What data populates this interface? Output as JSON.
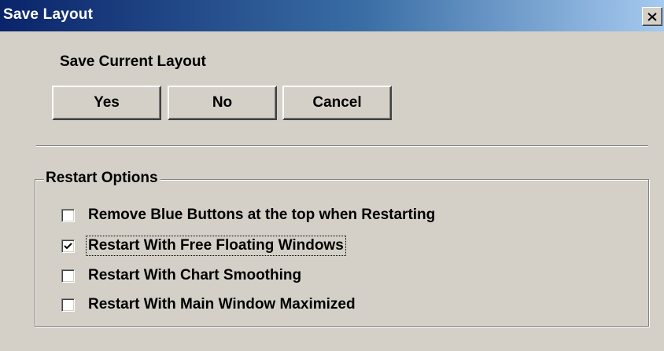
{
  "window": {
    "title": "Save Layout",
    "close_label": "✕"
  },
  "save": {
    "label": "Save Current Layout",
    "buttons": {
      "yes": "Yes",
      "no": "No",
      "cancel": "Cancel"
    }
  },
  "restart_options": {
    "title": "Restart Options",
    "options": [
      {
        "label": "Remove Blue Buttons at the top when Restarting",
        "checked": false
      },
      {
        "label": "Restart With Free Floating Windows",
        "checked": true,
        "focused": true
      },
      {
        "label": "Restart With Chart Smoothing",
        "checked": false
      },
      {
        "label": "Restart With Main Window Maximized",
        "checked": false
      }
    ]
  },
  "icons": {
    "close": "close-icon",
    "check": "checkmark-icon"
  },
  "colors": {
    "titlebar_start": "#0a246a",
    "titlebar_end": "#a6caf0",
    "face": "#d4d0c8"
  }
}
